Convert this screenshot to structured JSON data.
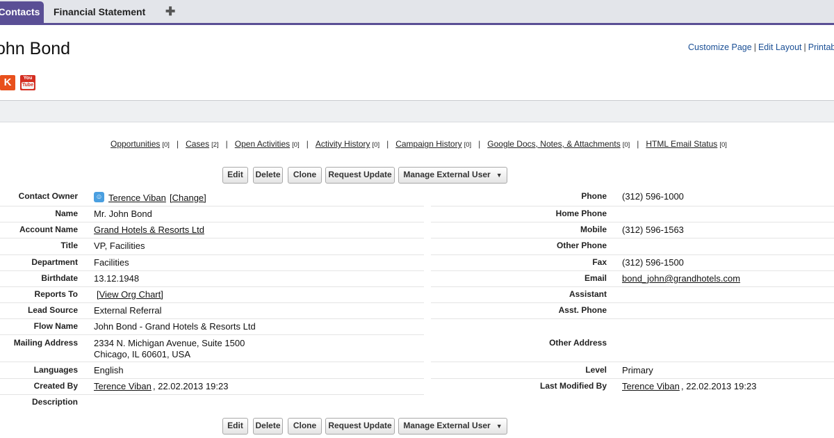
{
  "tabs": [
    {
      "label": "Contacts"
    },
    {
      "label": "Financial Statement"
    },
    {
      "label": "✚"
    }
  ],
  "header": {
    "title": "ohn Bond",
    "links": [
      "Customize Page",
      "Edit Layout",
      "Printabl"
    ],
    "separator": "|"
  },
  "social": {
    "klout_glyph": "K",
    "youtube_top": "You",
    "youtube_bottom": "Tube"
  },
  "related": [
    {
      "label": "Opportunities",
      "count": "[0]"
    },
    {
      "label": "Cases",
      "count": "[2]"
    },
    {
      "label": "Open Activities",
      "count": "[0]"
    },
    {
      "label": "Activity History",
      "count": "[0]"
    },
    {
      "label": "Campaign History",
      "count": "[0]"
    },
    {
      "label": "Google Docs, Notes, & Attachments",
      "count": "[0]"
    },
    {
      "label": "HTML Email Status",
      "count": "[0]"
    }
  ],
  "related_separator": "|",
  "buttons": {
    "edit": "Edit",
    "delete": "Delete",
    "clone": "Clone",
    "request_update": "Request Update",
    "manage_external": "Manage External User",
    "caret": "▼"
  },
  "left": {
    "contact_owner": {
      "label": "Contact Owner",
      "value": "Terence Viban",
      "change": "[Change]"
    },
    "name": {
      "label": "Name",
      "value": "Mr. John Bond"
    },
    "account_name": {
      "label": "Account Name",
      "value": "Grand Hotels & Resorts Ltd"
    },
    "title": {
      "label": "Title",
      "value": "VP, Facilities"
    },
    "department": {
      "label": "Department",
      "value": "Facilities"
    },
    "birthdate": {
      "label": "Birthdate",
      "value": "13.12.1948"
    },
    "reports_to": {
      "label": "Reports To",
      "value": "[View Org Chart]"
    },
    "lead_source": {
      "label": "Lead Source",
      "value": "External Referral"
    },
    "flow_name": {
      "label": "Flow Name",
      "value": "John Bond - Grand Hotels & Resorts Ltd"
    },
    "mailing_address": {
      "label": "Mailing Address",
      "line1": "2334 N. Michigan Avenue, Suite 1500",
      "line2": "Chicago, IL 60601, USA"
    },
    "languages": {
      "label": "Languages",
      "value": "English"
    },
    "created_by": {
      "label": "Created By",
      "user": "Terence Viban",
      "date": ", 22.02.2013 19:23"
    },
    "description": {
      "label": "Description",
      "value": ""
    }
  },
  "right": {
    "phone": {
      "label": "Phone",
      "value": "(312) 596-1000"
    },
    "home_phone": {
      "label": "Home Phone",
      "value": ""
    },
    "mobile": {
      "label": "Mobile",
      "value": "(312) 596-1563"
    },
    "other_phone": {
      "label": "Other Phone",
      "value": ""
    },
    "fax": {
      "label": "Fax",
      "value": "(312) 596-1500"
    },
    "email": {
      "label": "Email",
      "value": "bond_john@grandhotels.com"
    },
    "assistant": {
      "label": "Assistant",
      "value": ""
    },
    "asst_phone": {
      "label": "Asst. Phone",
      "value": ""
    },
    "other_address": {
      "label": "Other Address",
      "value": ""
    },
    "level": {
      "label": "Level",
      "value": "Primary"
    },
    "last_modified_by": {
      "label": "Last Modified By",
      "user": "Terence Viban",
      "date": ", 22.02.2013 19:23"
    }
  },
  "colors": {
    "tab_accent": "#5a4f95",
    "link_blue": "#1a4f95",
    "klout_orange": "#e8501c",
    "youtube_red": "#d42e21"
  }
}
